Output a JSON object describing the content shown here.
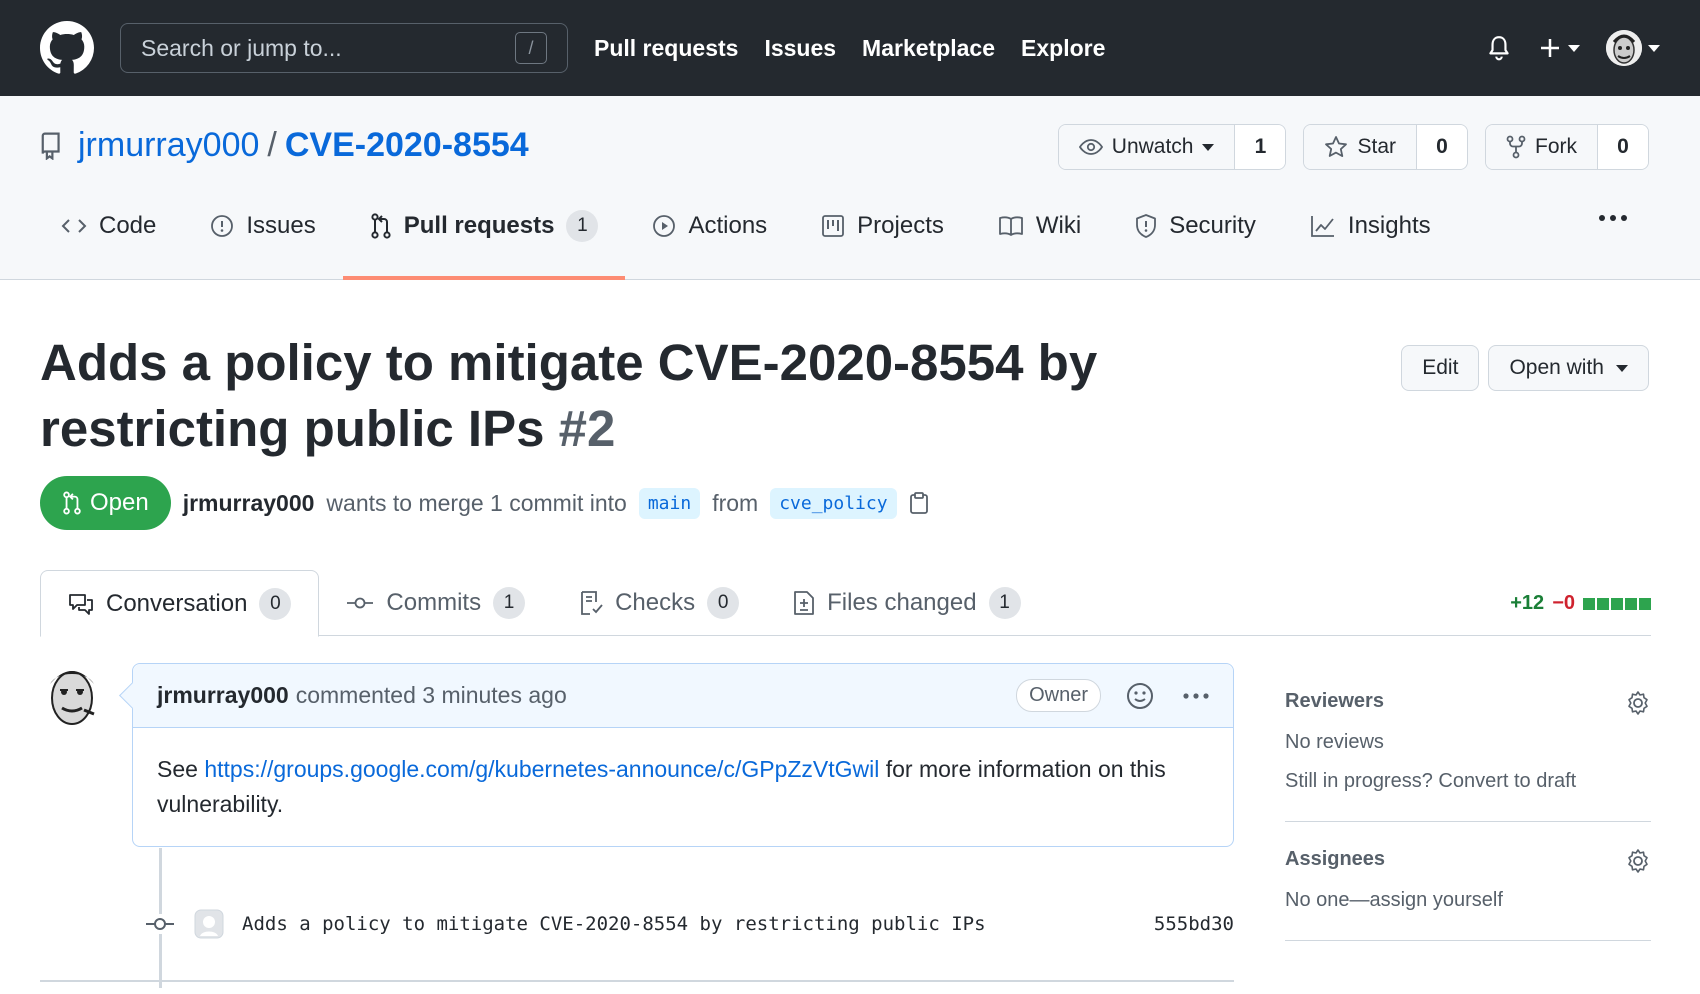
{
  "header": {
    "search_placeholder": "Search or jump to...",
    "search_shortcut": "/",
    "nav": [
      "Pull requests",
      "Issues",
      "Marketplace",
      "Explore"
    ]
  },
  "repo": {
    "owner": "jrmurray000",
    "separator": "/",
    "name": "CVE-2020-8554",
    "watch_label": "Unwatch",
    "watch_count": "1",
    "star_label": "Star",
    "star_count": "0",
    "fork_label": "Fork",
    "fork_count": "0",
    "tabs": {
      "code": "Code",
      "issues": "Issues",
      "pulls": "Pull requests",
      "pulls_count": "1",
      "actions": "Actions",
      "projects": "Projects",
      "wiki": "Wiki",
      "security": "Security",
      "insights": "Insights"
    }
  },
  "pr": {
    "title": "Adds a policy to mitigate CVE-2020-8554 by restricting public IPs",
    "number": "#2",
    "edit_label": "Edit",
    "open_with_label": "Open with",
    "state": "Open",
    "author": "jrmurray000",
    "merge_text_1": "wants to merge 1 commit into",
    "base_branch": "main",
    "merge_text_2": "from",
    "head_branch": "cve_policy",
    "tabs": {
      "conversation": "Conversation",
      "conversation_count": "0",
      "commits": "Commits",
      "commits_count": "1",
      "checks": "Checks",
      "checks_count": "0",
      "files": "Files changed",
      "files_count": "1"
    },
    "additions": "+12",
    "deletions": "−0"
  },
  "comment": {
    "author": "jrmurray000",
    "action": "commented 3 minutes ago",
    "badge": "Owner",
    "body_prefix": "See",
    "link": "https://groups.google.com/g/kubernetes-announce/c/GPpZzVtGwil",
    "body_suffix": "for more information on this vulnerability."
  },
  "commit": {
    "message": "Adds a policy to mitigate CVE-2020-8554 by restricting public IPs",
    "sha": "555bd30"
  },
  "sidebar": {
    "reviewers_title": "Reviewers",
    "reviewers_none": "No reviews",
    "reviewers_draft": "Still in progress? Convert to draft",
    "assignees_title": "Assignees",
    "assignees_none": "No one—assign yourself"
  },
  "colors": {
    "header_bg": "#24292f",
    "link": "#0969da",
    "open_green": "#2da44e",
    "selected_tab_underline": "#fd8c73"
  }
}
